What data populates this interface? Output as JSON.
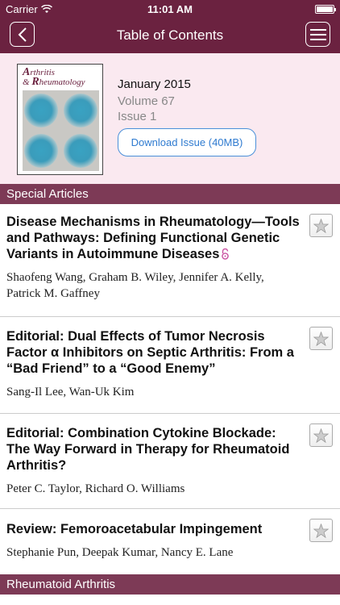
{
  "status_bar": {
    "carrier": "Carrier",
    "time": "11:01 AM"
  },
  "nav": {
    "title": "Table of Contents",
    "back_icon": "chevron-left-icon",
    "menu_icon": "hamburger-menu-icon"
  },
  "issue": {
    "cover_journal": "Arthritis & Rheumatology",
    "date": "January 2015",
    "volume": "Volume 67",
    "issue": "Issue 1",
    "download_label": "Download Issue (40MB)"
  },
  "sections": [
    {
      "title": "Special Articles",
      "articles": [
        {
          "title": "Disease Mechanisms in Rheumatology—Tools and Pathways: Defining Functional Genetic Variants in Autoimmune Diseases",
          "authors": "Shaofeng Wang, Graham B. Wiley, Jennifer A. Kelly, Patrick M. Gaffney",
          "open_access": true
        },
        {
          "title": "Editorial: Dual Effects of Tumor Necrosis Factor α Inhibitors on Septic Arthritis: From a “Bad Friend” to a “Good Enemy”",
          "authors": "Sang-Il Lee, Wan-Uk Kim",
          "open_access": false
        },
        {
          "title": "Editorial: Combination Cytokine Blockade: The Way Forward in Therapy for Rheumatoid Arthritis?",
          "authors": "Peter C. Taylor, Richard O. Williams",
          "open_access": false
        },
        {
          "title": "Review: Femoroacetabular Impingement",
          "authors": "Stephanie Pun, Deepak Kumar, Nancy E. Lane",
          "open_access": false
        }
      ]
    },
    {
      "title": "Rheumatoid Arthritis",
      "articles": []
    }
  ],
  "colors": {
    "brand": "#6b2240",
    "section": "#7d3a56",
    "header_bg": "#fae9f0",
    "link": "#2f7bd0"
  }
}
